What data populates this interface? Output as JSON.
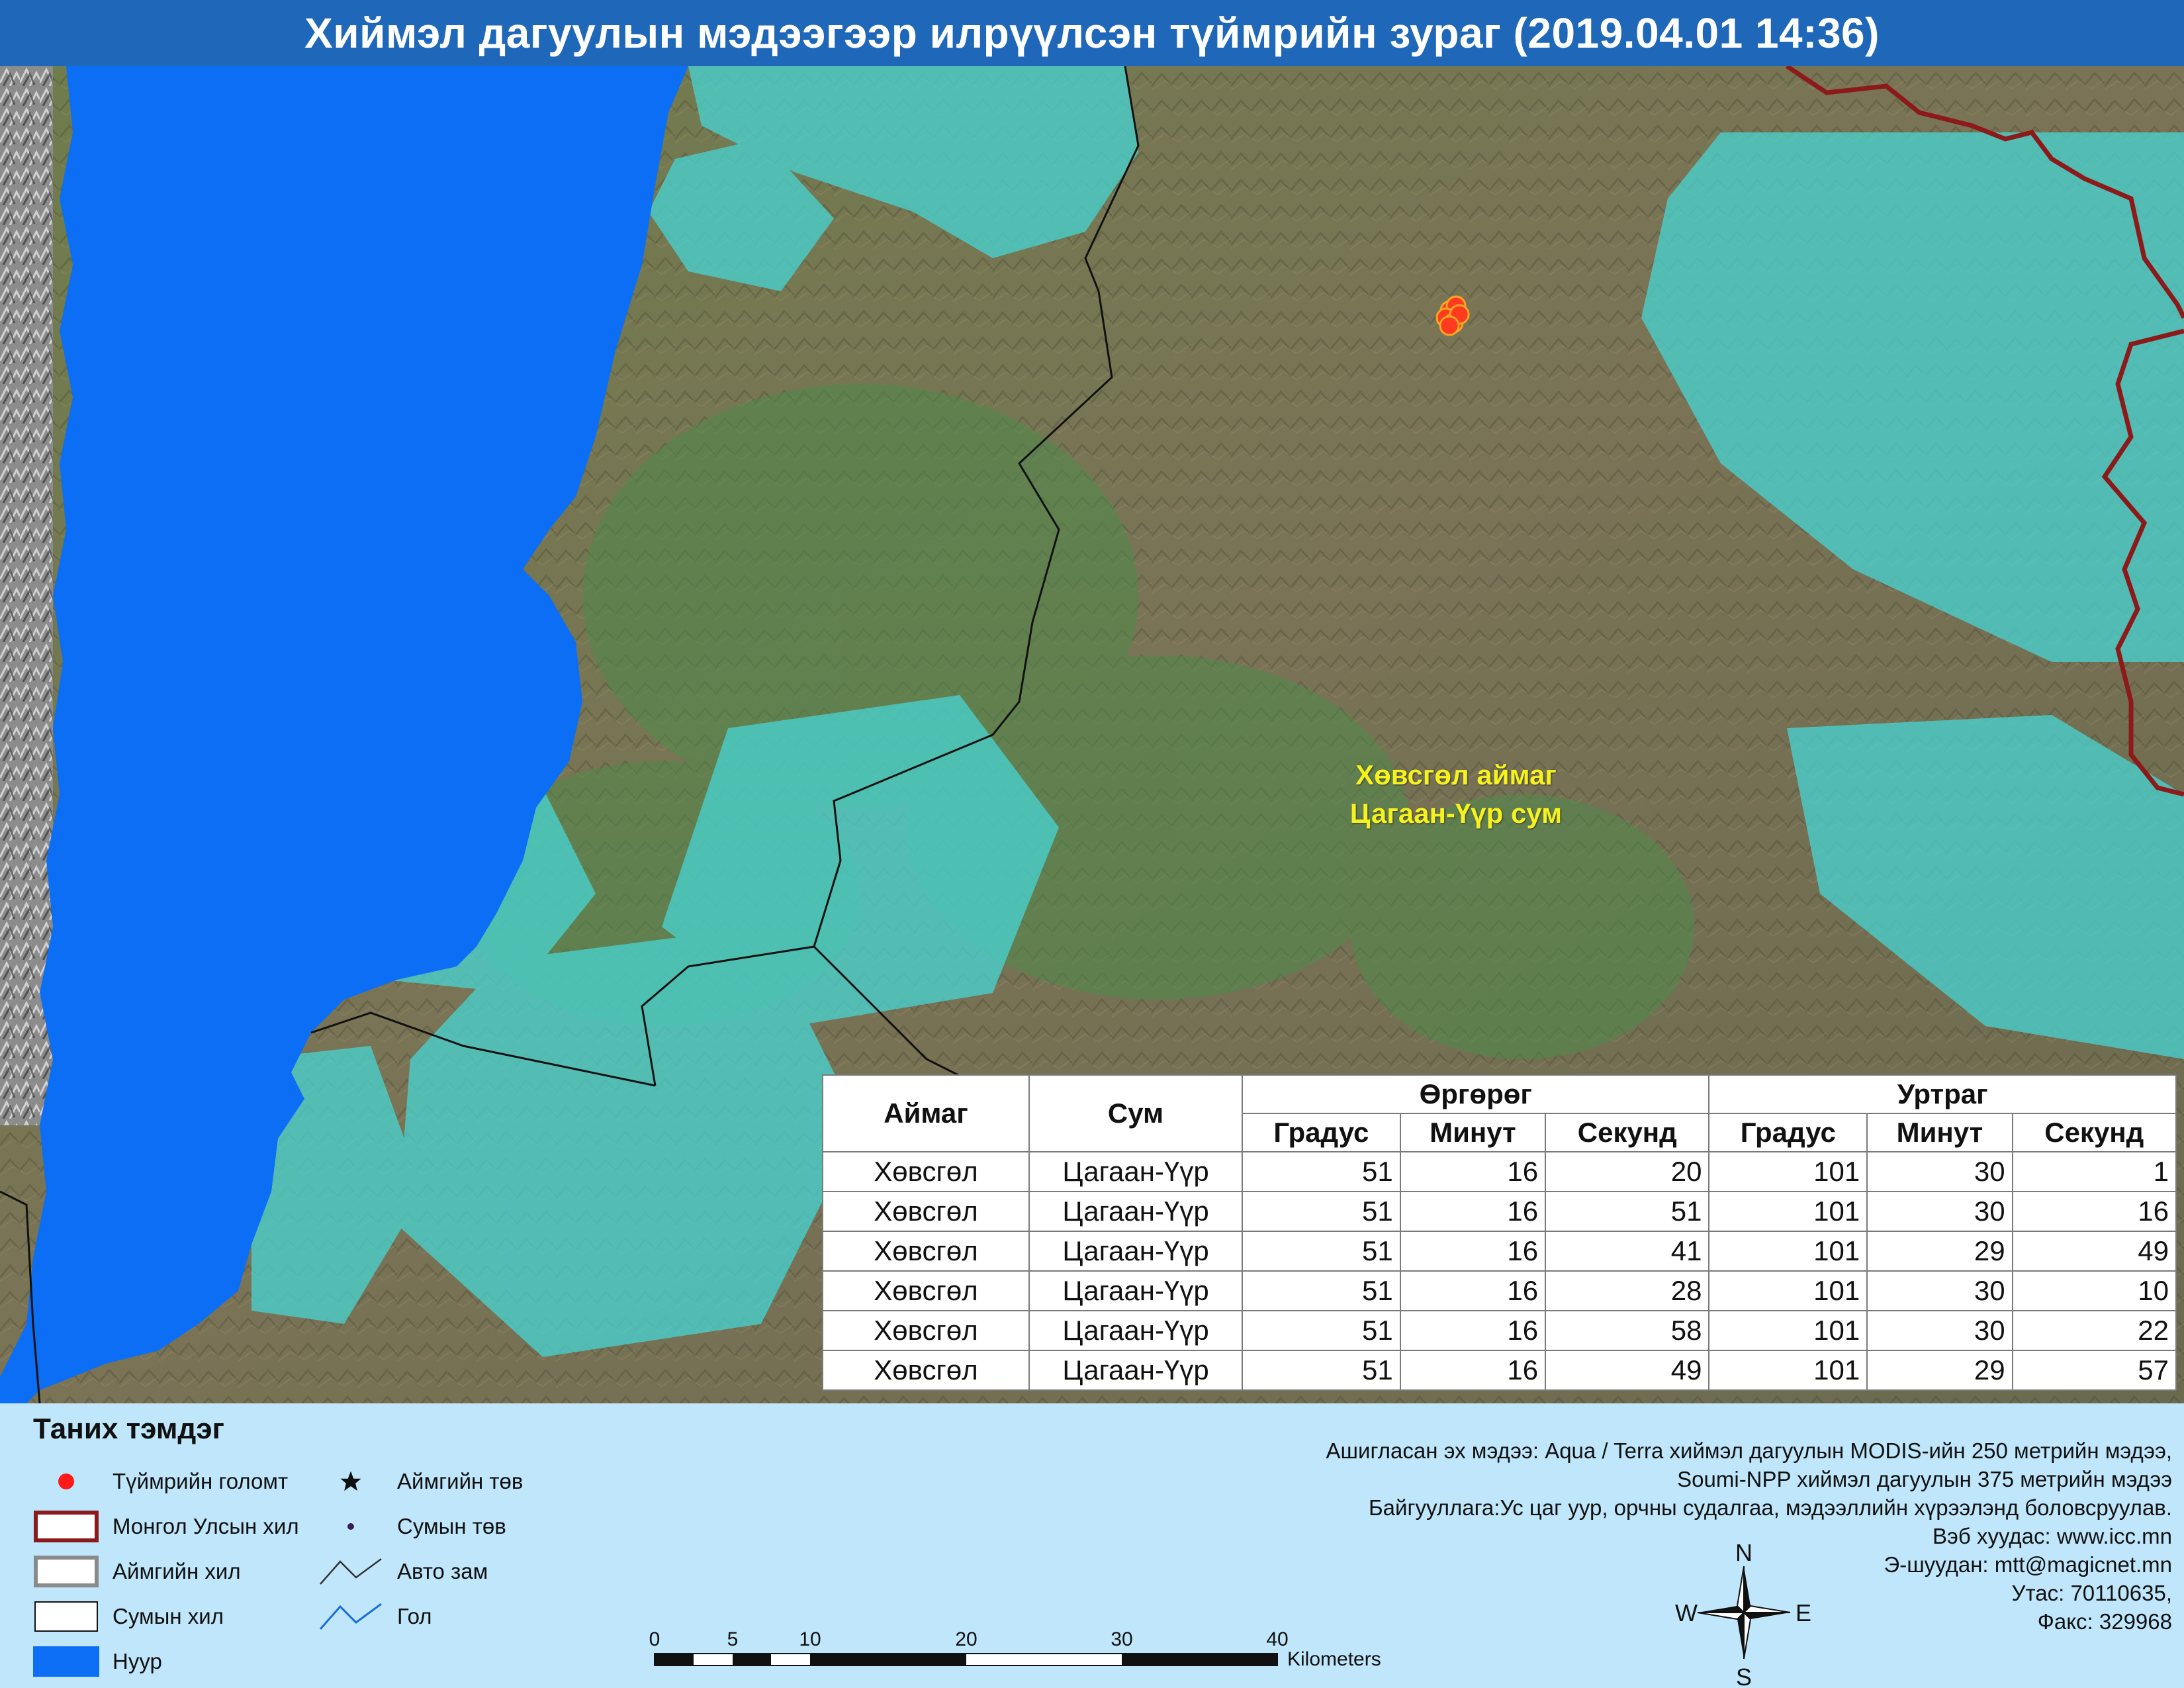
{
  "title": "Хиймэл дагуулын мэдээгээр илрүүлсэн түймрийн зураг  (2019.04.01 14:36)",
  "map": {
    "labels": {
      "aimag": "Хөвсгөл аймаг",
      "sum": "Цагаан-Үүр сум"
    },
    "colors": {
      "lake": "#0b6ef5",
      "national_border": "#8c1a1a",
      "sum_border": "#111111",
      "fire": "#ff3b1f",
      "fire_ring": "#f5a623"
    }
  },
  "table": {
    "headers": {
      "aimag": "Аймаг",
      "sum": "Сум",
      "lat_group": "Өргөрөг",
      "lon_group": "Уртраг",
      "lat_deg": "Градус",
      "lat_min": "Минут",
      "lat_sec": "Секунд",
      "lon_deg": "Градус",
      "lon_min": "Минут",
      "lon_sec": "Секунд"
    },
    "rows": [
      {
        "aimag": "Хөвсгөл",
        "sum": "Цагаан-Үүр",
        "lat_deg": "51",
        "lat_min": "16",
        "lat_sec": "20",
        "lon_deg": "101",
        "lon_min": "30",
        "lon_sec": "1"
      },
      {
        "aimag": "Хөвсгөл",
        "sum": "Цагаан-Үүр",
        "lat_deg": "51",
        "lat_min": "16",
        "lat_sec": "51",
        "lon_deg": "101",
        "lon_min": "30",
        "lon_sec": "16"
      },
      {
        "aimag": "Хөвсгөл",
        "sum": "Цагаан-Үүр",
        "lat_deg": "51",
        "lat_min": "16",
        "lat_sec": "41",
        "lon_deg": "101",
        "lon_min": "29",
        "lon_sec": "49"
      },
      {
        "aimag": "Хөвсгөл",
        "sum": "Цагаан-Үүр",
        "lat_deg": "51",
        "lat_min": "16",
        "lat_sec": "28",
        "lon_deg": "101",
        "lon_min": "30",
        "lon_sec": "10"
      },
      {
        "aimag": "Хөвсгөл",
        "sum": "Цагаан-Үүр",
        "lat_deg": "51",
        "lat_min": "16",
        "lat_sec": "58",
        "lon_deg": "101",
        "lon_min": "30",
        "lon_sec": "22"
      },
      {
        "aimag": "Хөвсгөл",
        "sum": "Цагаан-Үүр",
        "lat_deg": "51",
        "lat_min": "16",
        "lat_sec": "49",
        "lon_deg": "101",
        "lon_min": "29",
        "lon_sec": "57"
      }
    ]
  },
  "legend": {
    "title": "Таних тэмдэг",
    "items": {
      "fire": "Түймрийн голомт",
      "national_border": "Монгол Улсын хил",
      "aimag_border": "Аймгийн хил",
      "sum_border": "Сумын хил",
      "lake": "Нуур",
      "aimag_center": "Аймгийн төв",
      "sum_center": "Сумын төв",
      "road": "Авто зам",
      "river": "Гол"
    }
  },
  "scale": {
    "ticks": [
      "0",
      "5",
      "10",
      "20",
      "30",
      "40"
    ],
    "unit": "Kilometers"
  },
  "compass": {
    "n": "N",
    "s": "S",
    "e": "E",
    "w": "W"
  },
  "info": {
    "source_1": "Ашигласан эх мэдээ: Aqua / Terra хиймэл дагуулын MODIS-ийн 250 метрийн мэдээ,",
    "source_2": "Soumi-NPP хиймэл дагуулын 375 метрийн мэдээ",
    "org": "Байгууллага:Ус цаг уур, орчны судалгаа, мэдээллийн хүрээлэнд боловсруулав.",
    "web": "Вэб хуудас: www.icc.mn",
    "email": "Э-шуудан: mtt@magicnet.mn",
    "phone": "Утас: 70110635,",
    "fax": "Факс: 329968"
  }
}
